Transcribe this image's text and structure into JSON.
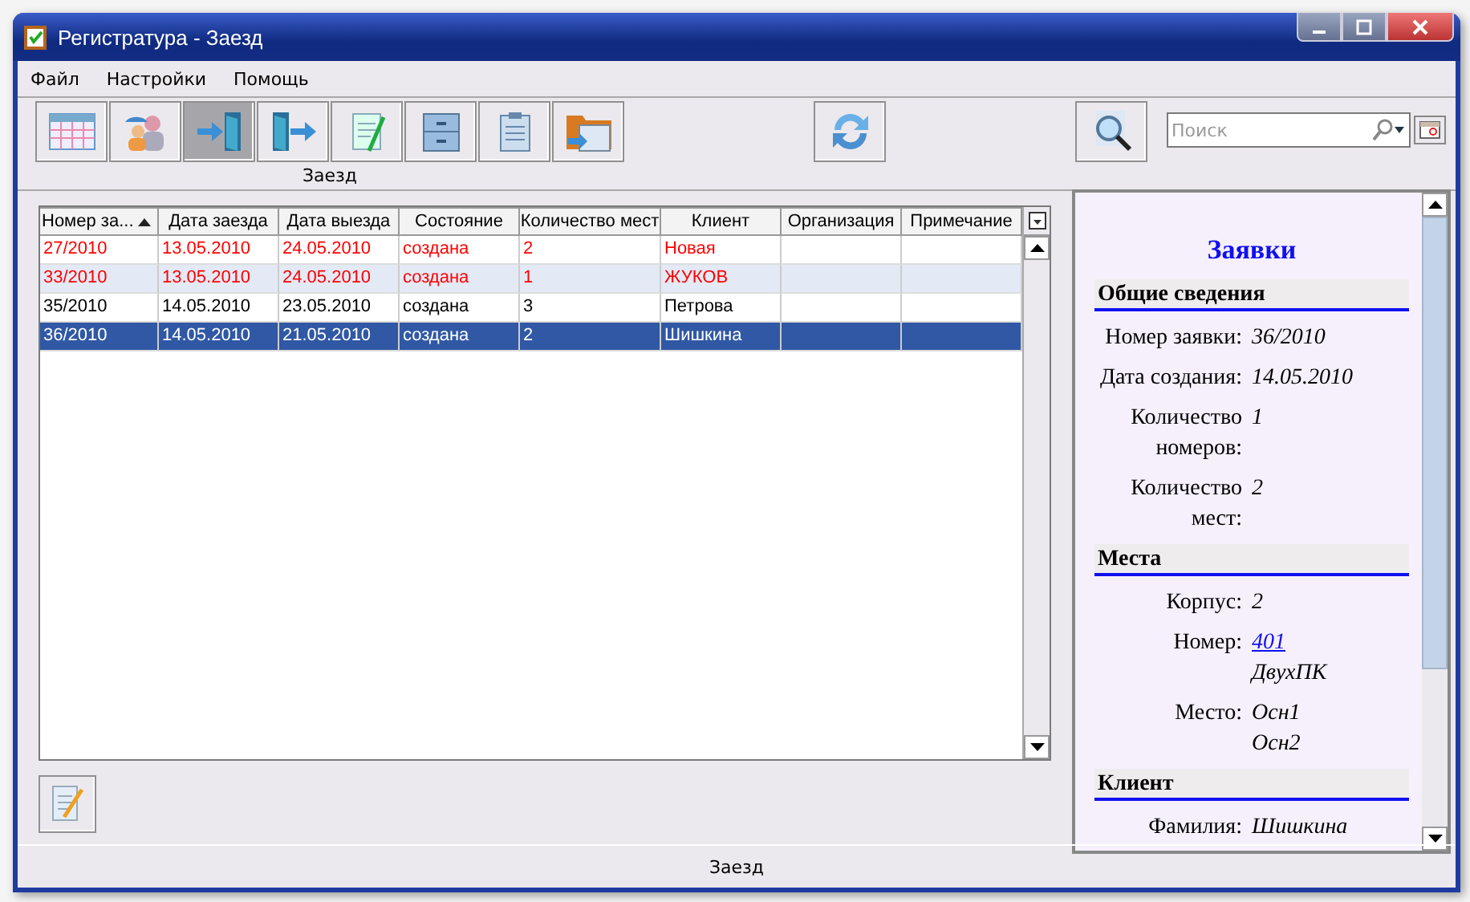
{
  "window": {
    "title": "Регистратура - Заезд"
  },
  "menu": [
    "Файл",
    "Настройки",
    "Помощь"
  ],
  "toolbar": {
    "buttons": [
      {
        "kind": "calendar",
        "selected": false
      },
      {
        "kind": "people",
        "selected": false
      },
      {
        "kind": "checkin",
        "selected": true
      },
      {
        "kind": "checkout",
        "selected": false
      },
      {
        "kind": "notepad",
        "selected": false
      },
      {
        "kind": "cabinet",
        "selected": false
      },
      {
        "kind": "clipboard",
        "selected": false
      },
      {
        "kind": "folder",
        "selected": false
      }
    ],
    "caption": "Заезд"
  },
  "search": {
    "placeholder": "Поиск"
  },
  "table": {
    "columns": [
      {
        "label": "Номер за...",
        "sorted": true
      },
      {
        "label": "Дата заезда",
        "sorted": false
      },
      {
        "label": "Дата выезда",
        "sorted": false
      },
      {
        "label": "Состояние",
        "sorted": false
      },
      {
        "label": "Количество мест",
        "sorted": false
      },
      {
        "label": "Клиент",
        "sorted": false
      },
      {
        "label": "Организация",
        "sorted": false
      },
      {
        "label": "Примечание",
        "sorted": false
      }
    ],
    "rows": [
      {
        "cells": [
          "27/2010",
          "13.05.2010",
          "24.05.2010",
          "создана",
          "2",
          "Новая",
          "",
          ""
        ],
        "color": "#ff0000",
        "selected": false
      },
      {
        "cells": [
          "33/2010",
          "13.05.2010",
          "24.05.2010",
          "создана",
          "1",
          "ЖУКОВ",
          "",
          ""
        ],
        "color": "#ff0000",
        "selected": false
      },
      {
        "cells": [
          "35/2010",
          "14.05.2010",
          "23.05.2010",
          "создана",
          "3",
          "Петрова",
          "",
          ""
        ],
        "color": "#000000",
        "selected": false
      },
      {
        "cells": [
          "36/2010",
          "14.05.2010",
          "21.05.2010",
          "создана",
          "2",
          "Шишкина",
          "",
          ""
        ],
        "selected": true
      }
    ]
  },
  "details": {
    "title": "Заявки",
    "sections": [
      {
        "heading": "Общие сведения",
        "fields": [
          {
            "label": "Номер заявки:",
            "values": [
              {
                "text": "36/2010",
                "link": false
              }
            ]
          },
          {
            "label": "Дата создания:",
            "values": [
              {
                "text": "14.05.2010",
                "link": false
              }
            ]
          },
          {
            "label": "Количество номеров:",
            "values": [
              {
                "text": "1",
                "link": false
              }
            ]
          },
          {
            "label": "Количество мест:",
            "values": [
              {
                "text": "2",
                "link": false
              }
            ]
          }
        ]
      },
      {
        "heading": "Места",
        "fields": [
          {
            "label": "Корпус:",
            "values": [
              {
                "text": "2",
                "link": false
              }
            ]
          },
          {
            "label": "Номер:",
            "values": [
              {
                "text": "401",
                "link": true
              },
              {
                "text": "ДвухПК",
                "link": false
              }
            ]
          },
          {
            "label": "Место:",
            "values": [
              {
                "text": "Осн1",
                "link": false
              },
              {
                "text": "Осн2",
                "link": false
              }
            ]
          }
        ]
      },
      {
        "heading": "Клиент",
        "fields": [
          {
            "label": "Фамилия:",
            "values": [
              {
                "text": "Шишкина",
                "link": false
              }
            ]
          }
        ]
      }
    ]
  },
  "status_bar": "Заезд"
}
